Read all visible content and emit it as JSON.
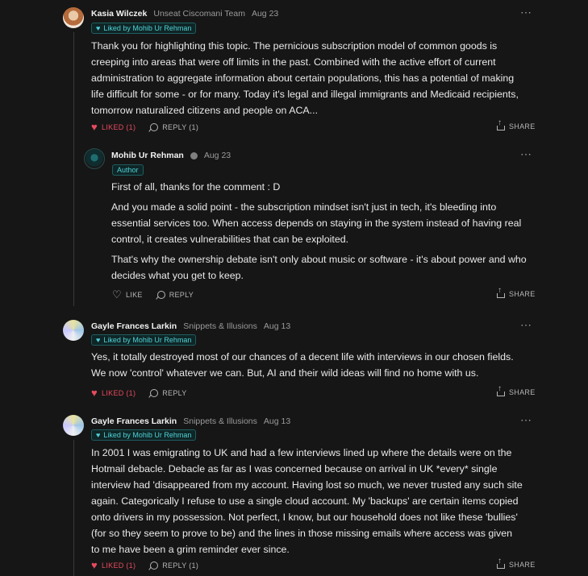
{
  "comments": [
    {
      "author": "Kasia Wilczek",
      "team": "Unseat Ciscomani Team",
      "date": "Aug 23",
      "liked_by": "Liked by Mohib Ur Rehman",
      "text": "Thank you for highlighting this topic. The pernicious subscription model of common goods is creeping into areas that were off limits in the past. Combined with the active effort of current administration to aggregate information about certain populations, this has a potential of making life difficult for some - or for many. Today it's legal and illegal immigrants and Medicaid recipients, tomorrow naturalized citizens and people on ACA...",
      "like_label": "LIKED (1)",
      "reply_label": "REPLY (1)",
      "share_label": "SHARE"
    },
    {
      "author": "Mohib Ur Rehman",
      "date": "Aug 23",
      "author_tag": "Author",
      "paragraphs": [
        "First of all, thanks for the comment : D",
        "And you made a solid point - the subscription mindset isn't just in tech, it's bleeding into essential services too. When access depends on staying in the system instead of having real control, it creates vulnerabilities that can be exploited.",
        "That's why the ownership debate isn't only about music or software - it's about power and who decides what you get to keep."
      ],
      "like_label": "LIKE",
      "reply_label": "REPLY",
      "share_label": "SHARE"
    },
    {
      "author": "Gayle Frances Larkin",
      "team": "Snippets & Illusions",
      "date": "Aug 13",
      "liked_by": "Liked by Mohib Ur Rehman",
      "text": "Yes, it totally destroyed most of our chances of a decent life with interviews in our chosen fields. We now 'control' whatever we can. But, AI and their wild ideas will find no home with us.",
      "like_label": "LIKED (1)",
      "reply_label": "REPLY",
      "share_label": "SHARE"
    },
    {
      "author": "Gayle Frances Larkin",
      "team": "Snippets & Illusions",
      "date": "Aug 13",
      "liked_by": "Liked by Mohib Ur Rehman",
      "text": "In 2001 I was emigrating to UK and had a few interviews lined up where the details were on the Hotmail debacle. Debacle as far as I was concerned because on arrival in UK *every* single interview had 'disappeared from my account. Having lost so much, we never trusted any such site again. Categorically I refuse to use a single cloud account. My 'backups' are certain items copied onto drivers in my possession. Not perfect, I know, but our household does not like these 'bullies' (for so they seem to prove to be) and the lines in those missing emails where access was given to me have been a grim reminder ever since.",
      "like_label": "LIKED (1)",
      "reply_label": "REPLY (1)",
      "share_label": "SHARE"
    }
  ],
  "more_icon": "⋯",
  "colors": {
    "accent": "#4fd2d6",
    "liked": "#e84a5f",
    "bg": "#161616"
  }
}
